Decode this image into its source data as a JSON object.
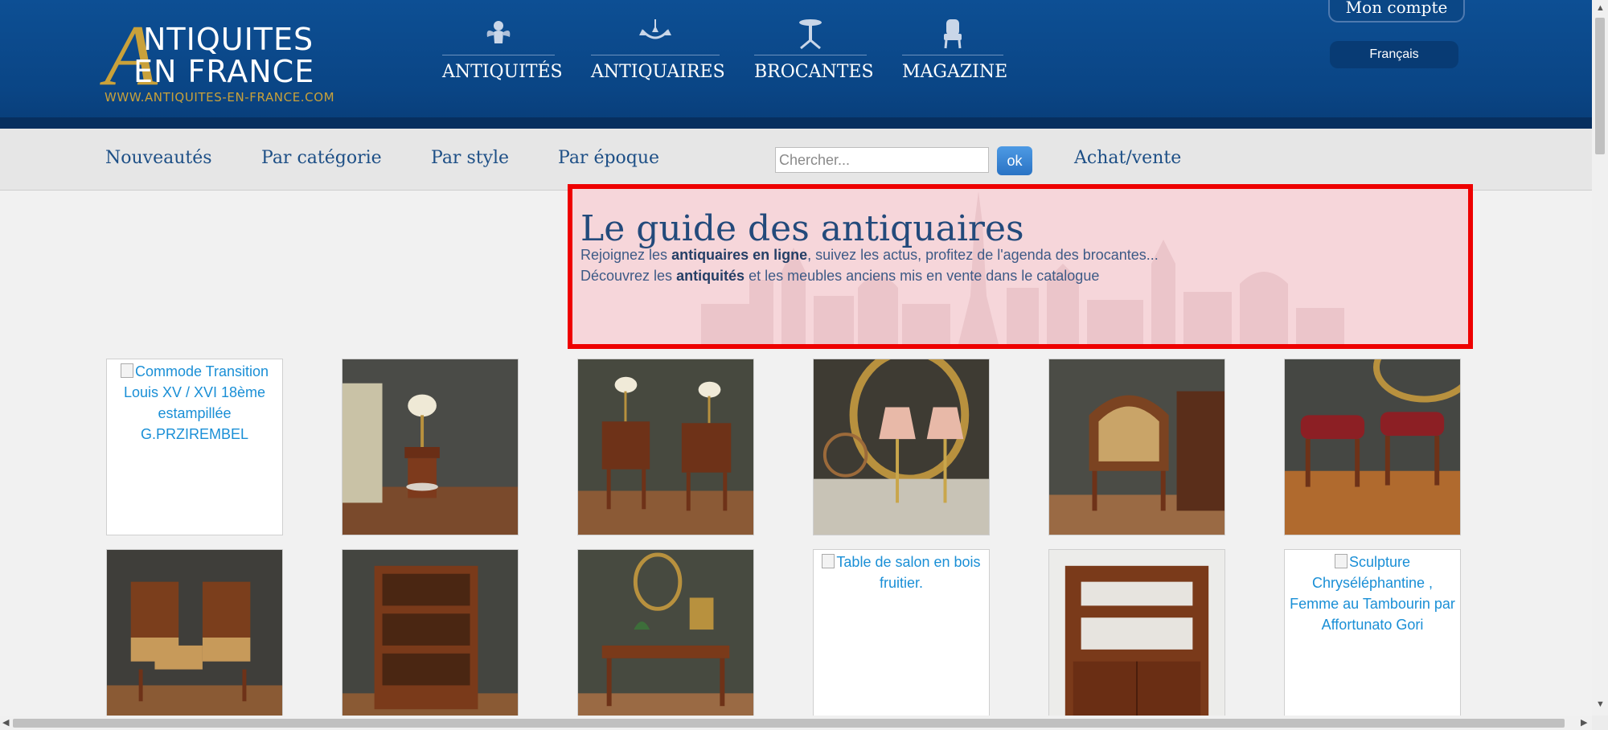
{
  "logo": {
    "line1": "NTIQUITES",
    "line2": "EN FRANCE",
    "initial": "A",
    "url": "WWW.ANTIQUITES-EN-FRANCE.COM"
  },
  "topnav": {
    "items": [
      {
        "label": "ANTIQUITÉS",
        "icon": "cherub-icon"
      },
      {
        "label": "ANTIQUAIRES",
        "icon": "chandelier-icon"
      },
      {
        "label": "BROCANTES",
        "icon": "pedestal-table-icon"
      },
      {
        "label": "MAGAZINE",
        "icon": "armchair-icon"
      }
    ]
  },
  "account": {
    "label": "Mon compte",
    "language": "Français"
  },
  "subnav": {
    "items": [
      "Nouveautés",
      "Par catégorie",
      "Par style",
      "Par époque"
    ],
    "search_placeholder": "Chercher...",
    "search_button": "ok",
    "extra_link": "Achat/vente"
  },
  "hero": {
    "title": "Le guide des antiquaires",
    "line1_pre": "Rejoignez les ",
    "line1_bold": "antiquaires en ligne",
    "line1_post": ", suivez les actus, profitez de l'agenda des brocantes...",
    "line2_pre": "Découvrez les ",
    "line2_bold": "antiquités",
    "line2_post": " et les meubles anciens mis en vente dans le catalogue"
  },
  "products": {
    "row1": [
      {
        "alt": "Commode Transition Louis XV / XVI 18ème estampillée G.PRZIREMBEL",
        "broken": true
      },
      {
        "alt": "",
        "broken": false,
        "scene": "side-table-lamp"
      },
      {
        "alt": "",
        "broken": false,
        "scene": "pair-nightstands"
      },
      {
        "alt": "",
        "broken": false,
        "scene": "lamps-mirror"
      },
      {
        "alt": "",
        "broken": false,
        "scene": "cane-armchair"
      },
      {
        "alt": "",
        "broken": false,
        "scene": "stools"
      }
    ],
    "row2": [
      {
        "alt": "",
        "broken": false,
        "scene": "chairs"
      },
      {
        "alt": "",
        "broken": false,
        "scene": "bookcase"
      },
      {
        "alt": "",
        "broken": false,
        "scene": "desk"
      },
      {
        "alt": "Table de salon en bois fruitier.",
        "broken": true
      },
      {
        "alt": "",
        "broken": false,
        "scene": "wall-shelf"
      },
      {
        "alt": "Sculpture Chryséléphantine , Femme au Tambourin par Affortunato Gori",
        "broken": true
      }
    ]
  },
  "colors": {
    "header": "#0a4585",
    "gold": "#c9a13a",
    "link": "#1d4f86",
    "alt_link": "#1a8fd6",
    "highlight_border": "#ee0000",
    "highlight_fill": "#f6d6da"
  }
}
